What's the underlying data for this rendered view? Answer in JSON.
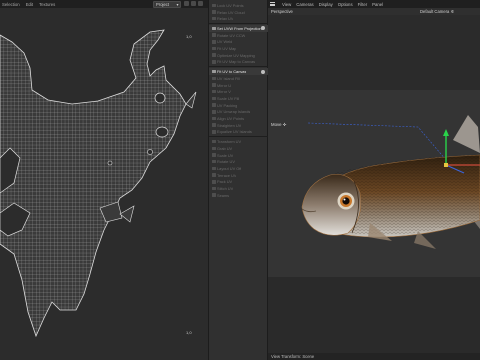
{
  "uv_editor": {
    "menu": [
      "Selection",
      "Edit",
      "Textures"
    ],
    "project_select": "Project",
    "coord_top_right": "1,0",
    "coord_bottom_right": "1,0"
  },
  "tools": [
    {
      "label": "Lock UV Points",
      "active": false
    },
    {
      "label": "Relax UV Cloud",
      "active": false
    },
    {
      "label": "Relax UV",
      "active": false
    },
    {
      "label": "Set UVW From Projection",
      "active": true,
      "gear": true
    },
    {
      "label": "Rotate UV CCW",
      "active": false
    },
    {
      "label": "UV Weld",
      "active": false
    },
    {
      "label": "Fit UV Map",
      "active": false
    },
    {
      "label": "Optimize UV Mapping",
      "active": false
    },
    {
      "label": "Fit UV Map to Canvas",
      "active": false
    },
    {
      "label": "Fit UV to Canvas",
      "active": true,
      "gear": true
    },
    {
      "label": "UV Island Fill",
      "active": false
    },
    {
      "label": "Mirror U",
      "active": false
    },
    {
      "label": "Mirror V",
      "active": false
    },
    {
      "label": "Scale UV Fill",
      "active": false
    },
    {
      "label": "UV Packing",
      "active": false
    },
    {
      "label": "UV Unwrap Islands",
      "active": false
    },
    {
      "label": "Align UV Points",
      "active": false
    },
    {
      "label": "Straighten UV",
      "active": false
    },
    {
      "label": "Equalize UV Islands",
      "active": false
    },
    {
      "label": "Transform UV",
      "active": false
    },
    {
      "label": "Grab UV",
      "active": false
    },
    {
      "label": "Scale UV",
      "active": false
    },
    {
      "label": "Rotate UV",
      "active": false
    },
    {
      "label": "Layout UV Off",
      "active": false
    },
    {
      "label": "Terrace UV",
      "active": false
    },
    {
      "label": "Pack UV",
      "active": false
    },
    {
      "label": "Stitch UV",
      "active": false
    },
    {
      "label": "Seams",
      "active": false
    }
  ],
  "viewport": {
    "menu": [
      "View",
      "Cameras",
      "Display",
      "Options",
      "Filter",
      "Panel"
    ],
    "mode_label": "Perspective",
    "camera_label": "Default Camera ✲",
    "move_label": "Move ✣",
    "footer": "View Transform: Scene"
  },
  "colors": {
    "uv_background": "#2c2c2c",
    "uv_wire": "#d2d2d2",
    "fish_body": "#5a3a1c",
    "fish_belly": "#9a8f83",
    "gizmo_green": "#29d34a",
    "gizmo_blue": "#3b63d8"
  }
}
